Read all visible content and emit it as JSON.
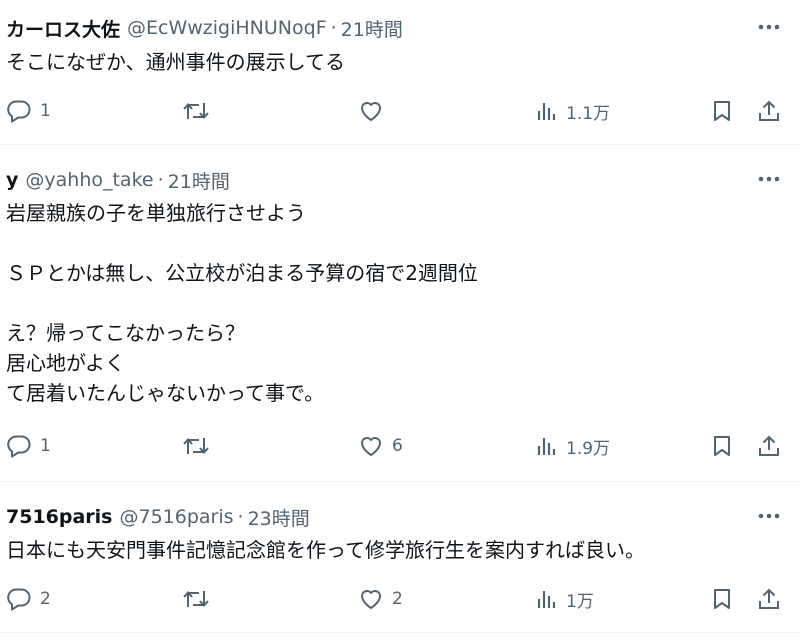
{
  "tweets": [
    {
      "name": "カーロス大佐",
      "handle": "@EcWwzigiHNUNoqF",
      "dot": "·",
      "time": "21時間",
      "text": "そこになぜか、通州事件の展示してる",
      "replies": "1",
      "retweets": "",
      "likes": "",
      "views": "1.1万"
    },
    {
      "name": "y",
      "handle": "@yahho_take",
      "dot": "·",
      "time": "21時間",
      "text": "岩屋親族の子を単独旅行させよう\n\nＳＰとかは無し、公立校が泊まる予算の宿で2週間位\n\nえ？帰ってこなかったら？\n居心地がよく\nて居着いたんじゃないかって事で。",
      "replies": "1",
      "retweets": "",
      "likes": "6",
      "views": "1.9万"
    },
    {
      "name": "7516paris",
      "handle": "@7516paris",
      "dot": "·",
      "time": "23時間",
      "text": "日本にも天安門事件記憶記念館を作って修学旅行生を案内すれば良い。",
      "replies": "2",
      "retweets": "",
      "likes": "2",
      "views": "1万"
    }
  ],
  "icons": {
    "more": "more-horizontal-icon",
    "reply": "reply-bubble-icon",
    "retweet": "retweet-icon",
    "like": "heart-icon",
    "views": "analytics-bars-icon",
    "bookmark": "bookmark-icon",
    "share": "share-upload-icon"
  },
  "colors": {
    "text": "#0f1419",
    "secondary": "#536471",
    "separator": "#eff3f4"
  }
}
